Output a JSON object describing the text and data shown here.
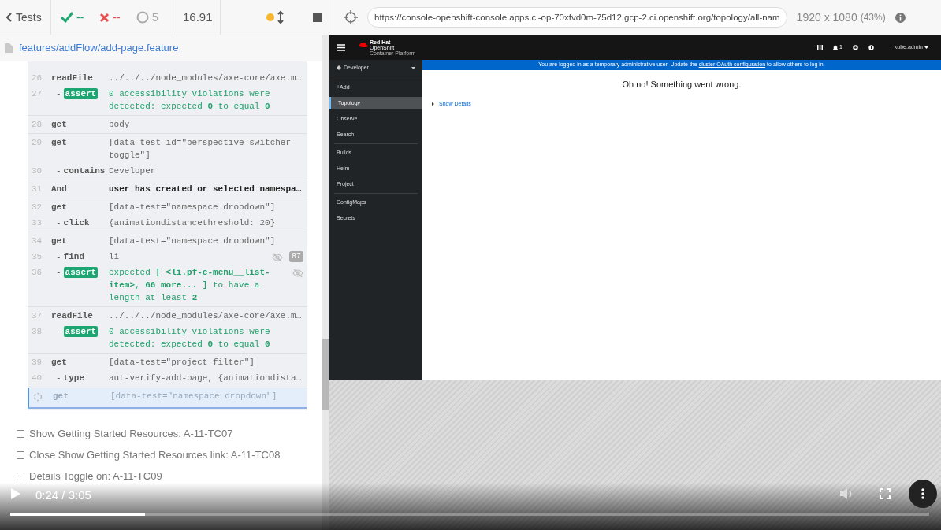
{
  "runner": {
    "back_label": "Tests",
    "passed": "--",
    "failed": "--",
    "pending": "5",
    "duration": "16.91",
    "url": "https://console-openshift-console.apps.ci-op-70xfvd0m-75d12.gcp-2.ci.openshift.org/topology/all-nam",
    "viewport": "1920 x 1080",
    "scale": "(43%)"
  },
  "spec_path": "features/addFlow/add-page.feature",
  "command_groups": [
    {
      "rows": [
        {
          "num": "26",
          "name": "readFile",
          "message": "../../../node_modules/axe-core/axe.m…",
          "kind": "command"
        },
        {
          "num": "27",
          "prefix": "-",
          "name": "assert",
          "message": "0 accessibility violations were detected: expected **0** to equal **0**",
          "kind": "assert"
        }
      ]
    },
    {
      "rows": [
        {
          "num": "28",
          "name": "get",
          "message": "body",
          "kind": "command"
        }
      ]
    },
    {
      "rows": [
        {
          "num": "29",
          "name": "get",
          "message": "[data-test-id=\"perspective-switcher-toggle\"]",
          "kind": "command"
        },
        {
          "num": "30",
          "prefix": "-",
          "name": "contains",
          "message": "Developer",
          "kind": "command"
        }
      ]
    },
    {
      "rows": [
        {
          "num": "31",
          "name": "And",
          "message": "user has created or selected namespa…",
          "kind": "step"
        }
      ]
    },
    {
      "rows": [
        {
          "num": "32",
          "name": "get",
          "message": "[data-test=\"namespace dropdown\"]",
          "kind": "command"
        },
        {
          "num": "33",
          "prefix": "-",
          "name": "click",
          "message": "{animationdistancethreshold: 20}",
          "kind": "command"
        }
      ]
    },
    {
      "rows": [
        {
          "num": "34",
          "name": "get",
          "message": "[data-test=\"namespace dropdown\"]",
          "kind": "command"
        },
        {
          "num": "35",
          "prefix": "-",
          "name": "find",
          "message": "li",
          "kind": "command",
          "hidden": true,
          "count": "87"
        },
        {
          "num": "36",
          "prefix": "-",
          "name": "assert",
          "message": "expected **[ <li.pf-c-menu__list-item>, 66 more... ]** to have a length at least **2**",
          "kind": "assert",
          "hidden": true
        }
      ]
    },
    {
      "rows": [
        {
          "num": "37",
          "name": "readFile",
          "message": "../../../node_modules/axe-core/axe.m…",
          "kind": "command"
        },
        {
          "num": "38",
          "prefix": "-",
          "name": "assert",
          "message": "0 accessibility violations were detected: expected **0** to equal **0**",
          "kind": "assert"
        }
      ]
    },
    {
      "rows": [
        {
          "num": "39",
          "name": "get",
          "message": "[data-test=\"project filter\"]",
          "kind": "command"
        },
        {
          "num": "40",
          "prefix": "-",
          "name": "type",
          "message": "aut-verify-add-page, {animationdista…",
          "kind": "command"
        }
      ]
    },
    {
      "rows": [
        {
          "name": "get",
          "message": "[data-test=\"namespace dropdown\"]",
          "kind": "pending"
        }
      ]
    }
  ],
  "tests": [
    {
      "title": "Show Getting Started Resources: A-11-TC07",
      "checked": false
    },
    {
      "title": "Close Show Getting Started Resources link: A-11-TC08",
      "checked": false
    },
    {
      "title": "Details Toggle on: A-11-TC09",
      "checked": false
    }
  ],
  "app": {
    "brand": [
      "Red Hat",
      "OpenShift",
      "Container Platform"
    ],
    "notifications": "1",
    "user": "kube:admin",
    "perspective": "Developer",
    "nav": [
      {
        "label": "+Add",
        "selected": false,
        "divider": false
      },
      {
        "label": "Topology",
        "selected": true,
        "divider": false
      },
      {
        "label": "Observe",
        "selected": false,
        "divider": false
      },
      {
        "label": "Search",
        "selected": false,
        "divider": true
      },
      {
        "label": "Builds",
        "selected": false,
        "divider": false
      },
      {
        "label": "Helm",
        "selected": false,
        "divider": false
      },
      {
        "label": "Project",
        "selected": false,
        "divider": true
      },
      {
        "label": "ConfigMaps",
        "selected": false,
        "divider": false
      },
      {
        "label": "Secrets",
        "selected": false,
        "divider": false
      }
    ],
    "banner": "You are logged in as a temporary administrative user. Update the",
    "banner_link": "cluster OAuth configuration",
    "banner_end": "to allow others to log in.",
    "error": "Oh no! Something went wrong.",
    "details_link": "Show Details"
  },
  "video": {
    "time": "0:24 / 3:05",
    "level": 0.147
  }
}
